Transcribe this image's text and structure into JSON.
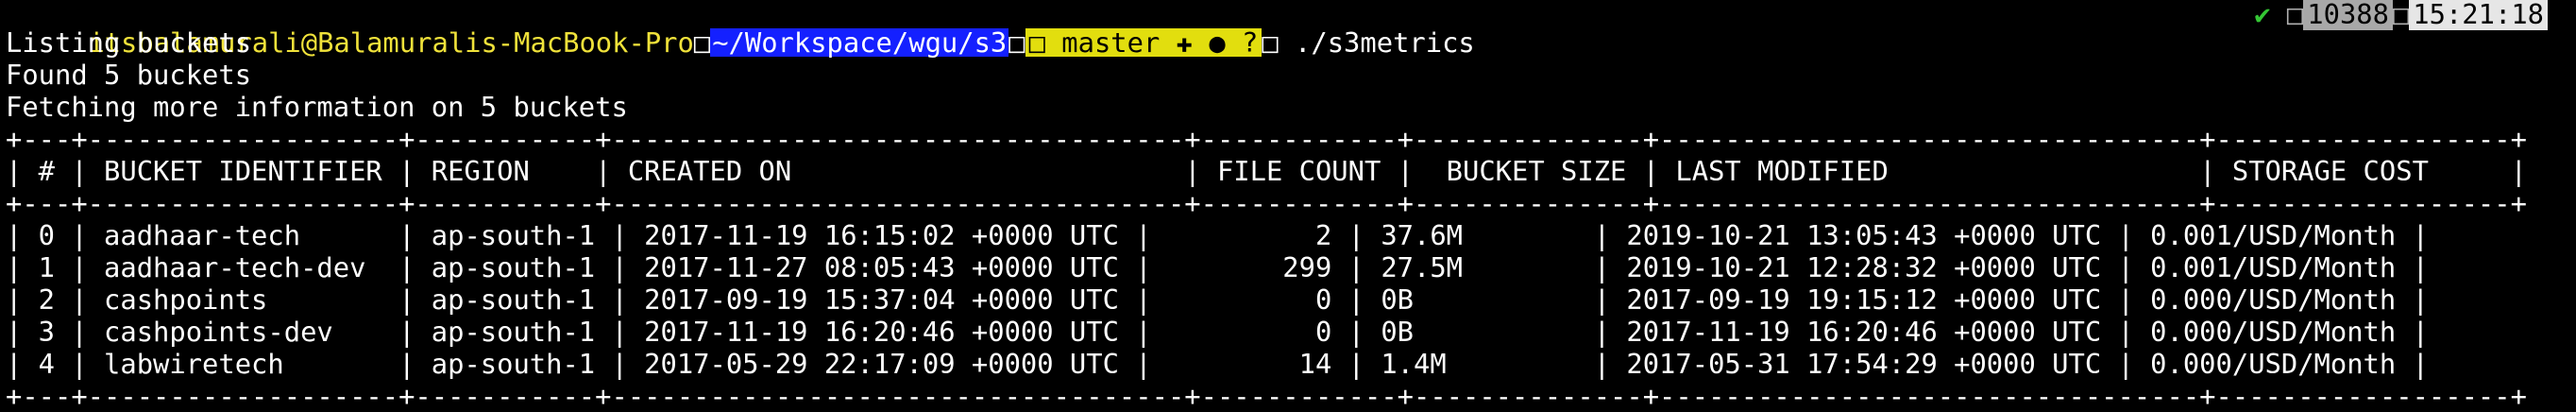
{
  "prompt": {
    "user_host": "itsbalamurali@Balamuralis-MacBook-Pro",
    "dir_sep": "□",
    "directory": "~/Workspace/wgu/s3",
    "git_sep": "□",
    "git_branch_icon": "□",
    "git_branch": "master",
    "git_status": "✚ ● ?",
    "cmd_sep": "□",
    "command": "./s3metrics",
    "status_check": "✔",
    "status_sep1": "□",
    "history_count": "10388",
    "status_sep2": "□",
    "clock": "15:21:18",
    "colors": {
      "user": "#f0e23a",
      "dir_bg": "#1420ff",
      "git_bg": "#e2de0e",
      "check": "#34c634"
    }
  },
  "output": {
    "line1": "Listing buckets",
    "line2": "Found 5 buckets",
    "line3": "Fetching more information on 5 buckets"
  },
  "table": {
    "border": "+---+-------------------+-----------+-----------------------------------+------------+--------------+---------------------------------+------------------+",
    "header": "| # | BUCKET IDENTIFIER | REGION    | CREATED ON                        | FILE COUNT |  BUCKET SIZE | LAST MODIFIED                   | STORAGE COST     |",
    "rows": [
      "| 0 | aadhaar-tech      | ap-south-1 | 2017-11-19 16:15:02 +0000 UTC |          2 | 37.6M        | 2019-10-21 13:05:43 +0000 UTC | 0.001/USD/Month |",
      "| 1 | aadhaar-tech-dev  | ap-south-1 | 2017-11-27 08:05:43 +0000 UTC |        299 | 27.5M        | 2019-10-21 12:28:32 +0000 UTC | 0.001/USD/Month |",
      "| 2 | cashpoints        | ap-south-1 | 2017-09-19 15:37:04 +0000 UTC |          0 | 0B           | 2017-09-19 19:15:12 +0000 UTC | 0.000/USD/Month |",
      "| 3 | cashpoints-dev    | ap-south-1 | 2017-11-19 16:20:46 +0000 UTC |          0 | 0B           | 2017-11-19 16:20:46 +0000 UTC | 0.000/USD/Month |",
      "| 4 | labwiretech       | ap-south-1 | 2017-05-29 22:17:09 +0000 UTC |         14 | 1.4M         | 2017-05-31 17:54:29 +0000 UTC | 0.000/USD/Month |"
    ]
  }
}
